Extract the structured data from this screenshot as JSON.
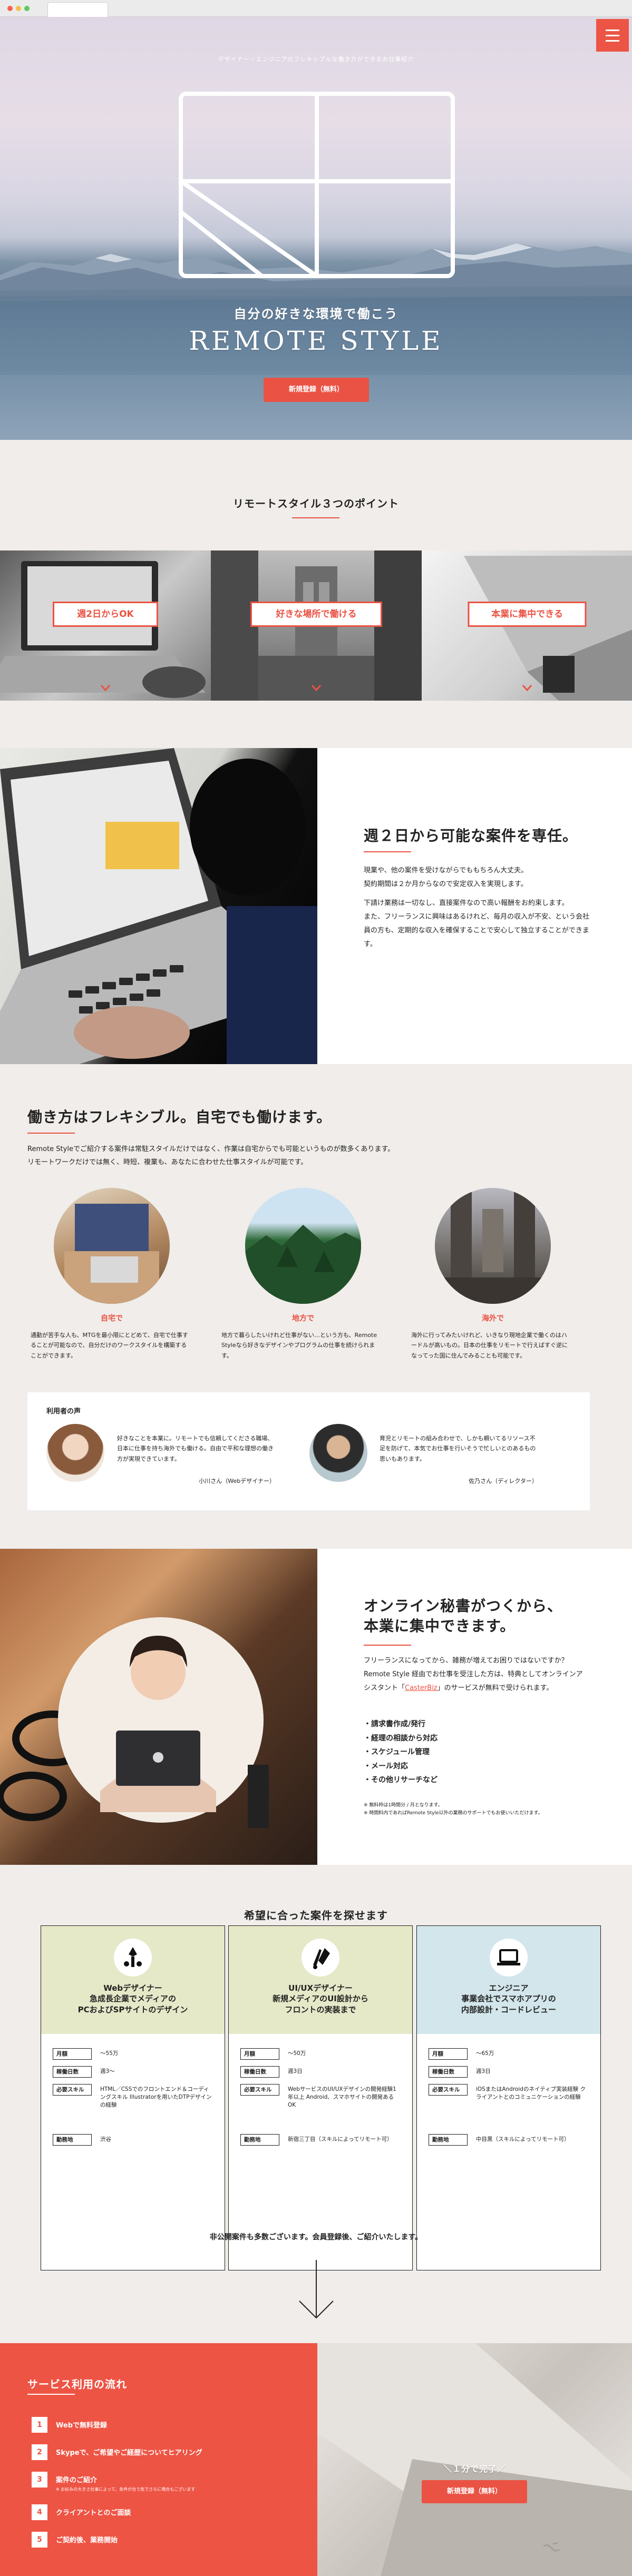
{
  "browser": {
    "dot_colors": [
      "#f5614f",
      "#f6bf4f",
      "#5ec95d"
    ]
  },
  "hero": {
    "tagline": "デザイナー・エンジニアのフレキシブルな働き方ができるお仕事紹介",
    "subtitle": "自分の好きな環境で働こう",
    "title": "REMOTE STYLE",
    "cta_label": "新規登録（無料）",
    "menu_icon": "hamburger-menu-icon"
  },
  "points": {
    "title": "リモートスタイル３つのポイント",
    "panels": [
      {
        "label": "週2日からOK"
      },
      {
        "label": "好きな場所で働ける"
      },
      {
        "label": "本業に集中できる"
      }
    ]
  },
  "feature1": {
    "title": "週２日から可能な案件を専任。",
    "body": [
      "現業や、他の案件を受けながらでももちろん大丈夫。",
      "契約期間は２か月からなので安定収入を実現します。",
      "",
      "下請け業務は一切なし、直接案件なので高い報酬をお約束します。",
      "また、フリーランスに興味はあるけれど、毎月の収入が不安、という会社員の方も、定期的な収入を確保することで安心して独立することができます。"
    ]
  },
  "flexible": {
    "title": "働き方はフレキシブル。自宅でも働けます。",
    "intro": [
      "Remote Styleでご紹介する案件は常駐スタイルだけではなく、作業は自宅からでも可能というものが数多くあります。",
      "リモートワークだけでは無く、時短、複業も、あなたに合わせた仕事スタイルが可能です。"
    ],
    "places": [
      {
        "label": "自宅で",
        "desc": "通勤が苦手な人も、MTGを最小限にとどめて、自宅で仕事することが可能なので、自分だけのワークスタイルを構築することができます。"
      },
      {
        "label": "地方で",
        "desc": "地方で暮らしたいけれど仕事がない…という方も、Remote Styleなら好きなデザインやプログラムの仕事を続けられます。"
      },
      {
        "label": "海外で",
        "desc": "海外に行ってみたいけれど、いきなり現地企業で働くのはハードルが高いもの。日本の仕事をリモートで行えばすぐ逆になってった国に住んでみることも可能です。"
      }
    ],
    "voices_title": "利用者の声",
    "voices": [
      {
        "text": "好きなことを本業に。リモートでも信頼してくださる職場、日本に仕事を持ち海外でも働ける。自由で平和な理想の働き方が実現できています。",
        "name": "小川さん（Webデザイナー）"
      },
      {
        "text": "育児とリモートの組み合わせで、しかも頼いてるリソース不足を防げて、本気でお仕事を行いそうで忙しいとのあるもの思いもあります。",
        "name": "佐乃さん（ディレクター）"
      }
    ]
  },
  "secretary": {
    "title_lines": [
      "オンライン秘書がつくから、",
      "本業に集中できます。"
    ],
    "body_parts": [
      "フリーランスになってから、雑務が増えてお困りではないですか？ Remote Style 経由でお仕事を受注した方は、特典としてオンラインアシスタント「",
      "CasterBiz",
      "」のサービスが無料で受けられます。"
    ],
    "items": [
      "請求書作成/発行",
      "経理の相談から対応",
      "スケジュール管理",
      "メール対応",
      "その他リサーチなど"
    ],
    "notes": [
      "※ 無料枠は1時間分 / 月となります。",
      "※ 時間料内であればRemote Style以外の業務のサポートでもお使いいただけます。"
    ]
  },
  "jobs": {
    "title": "希望に合った案件を探せます",
    "cards": [
      {
        "role": "Webデザイナー",
        "summary": [
          "急成長企業でメディアの",
          "PCおよびSPサイトのデザイン"
        ],
        "rows": [
          {
            "label": "月額",
            "value": "〜55万"
          },
          {
            "label": "稼働日数",
            "value": "週3〜"
          },
          {
            "label": "必要スキル",
            "value": "HTML／CSSでのフロントエンド＆コーディングスキル Illustratorを用いたDTPデザインの経験"
          },
          {
            "label": "勤務地",
            "value": "渋谷"
          }
        ],
        "icon": "web-designer-icon"
      },
      {
        "role": "UI/UXデザイナー",
        "summary": [
          "新規メディアのUI設計から",
          "フロントの実装まで"
        ],
        "rows": [
          {
            "label": "月額",
            "value": "〜50万"
          },
          {
            "label": "稼働日数",
            "value": "週3日"
          },
          {
            "label": "必要スキル",
            "value": "WebサービスのUI/UXデザインの開発経験1年以上 Android、スマホサイトの開発あるOK"
          },
          {
            "label": "勤務地",
            "value": "新宿三丁目（スキルによってリモート可）"
          }
        ],
        "icon": "ui-designer-icon"
      },
      {
        "role": "エンジニア",
        "summary": [
          "事業会社でスマホアプリの",
          "内部設計・コードレビュー"
        ],
        "rows": [
          {
            "label": "月額",
            "value": "〜65万"
          },
          {
            "label": "稼働日数",
            "value": "週3日"
          },
          {
            "label": "必要スキル",
            "value": "iOSまたはAndroidのネイティブ実装経験 クライアントとのコミュニケーションの経験"
          },
          {
            "label": "勤務地",
            "value": "中目黒（スキルによってリモート可）"
          }
        ],
        "icon": "laptop-icon"
      }
    ],
    "footer_note": "非公開案件も多数ございます。会員登録後、ご紹介いたします。",
    "head_colors": [
      "#e5e9c8",
      "#e5e9c8",
      "#d2e6eb"
    ]
  },
  "service_flow": {
    "title": "サービス利用の流れ",
    "steps": [
      {
        "num": "1",
        "label": "Webで無料登録",
        "note": ""
      },
      {
        "num": "2",
        "label": "Skypeで、ご希望やご経歴についてヒアリング",
        "note": ""
      },
      {
        "num": "3",
        "label": "案件のご紹介",
        "note": "※ お好みの大きさ仕事によって、条件が合う気でさらに場合もございます"
      },
      {
        "num": "4",
        "label": "クライアントとのご面談",
        "note": ""
      },
      {
        "num": "5",
        "label": "ご契約後、業務開始",
        "note": ""
      }
    ],
    "cta_caption": "＼１分で完了／",
    "cta_label": "新規登録（無料）"
  }
}
